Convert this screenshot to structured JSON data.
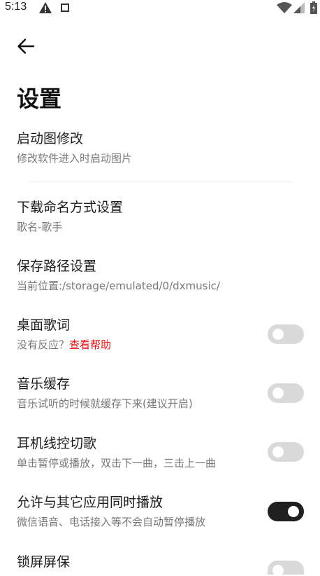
{
  "status_bar": {
    "time": "5:13",
    "icons": [
      "warning-icon",
      "square-icon",
      "wifi-icon",
      "signal-icon",
      "battery-icon"
    ]
  },
  "header": {
    "back_icon": "arrow-left-icon",
    "title": "设置"
  },
  "settings": [
    {
      "title": "启动图修改",
      "subtitle": "修改软件进入时启动图片"
    },
    {
      "title": "下载命名方式设置",
      "subtitle": "歌名-歌手"
    },
    {
      "title": "保存路径设置",
      "subtitle": "当前位置:/storage/emulated/0/dxmusic/"
    },
    {
      "title": "桌面歌词",
      "subtitle": "没有反应？",
      "link": "查看帮助",
      "toggle": false
    },
    {
      "title": "音乐缓存",
      "subtitle": "音乐试听的时候就缓存下来(建议开启)",
      "toggle": false
    },
    {
      "title": "耳机线控切歌",
      "subtitle": "单击暂停或播放，双击下一曲，三击上一曲",
      "toggle": false
    },
    {
      "title": "允许与其它应用同时播放",
      "subtitle": "微信语音、电话接入等不会自动暂停播放",
      "toggle": true
    },
    {
      "title": "锁屏屏保",
      "toggle": false
    }
  ],
  "colors": {
    "link": "#e01818",
    "toggle_on": "#202020",
    "toggle_off": "#d9d9d9",
    "subtitle": "#777777"
  }
}
